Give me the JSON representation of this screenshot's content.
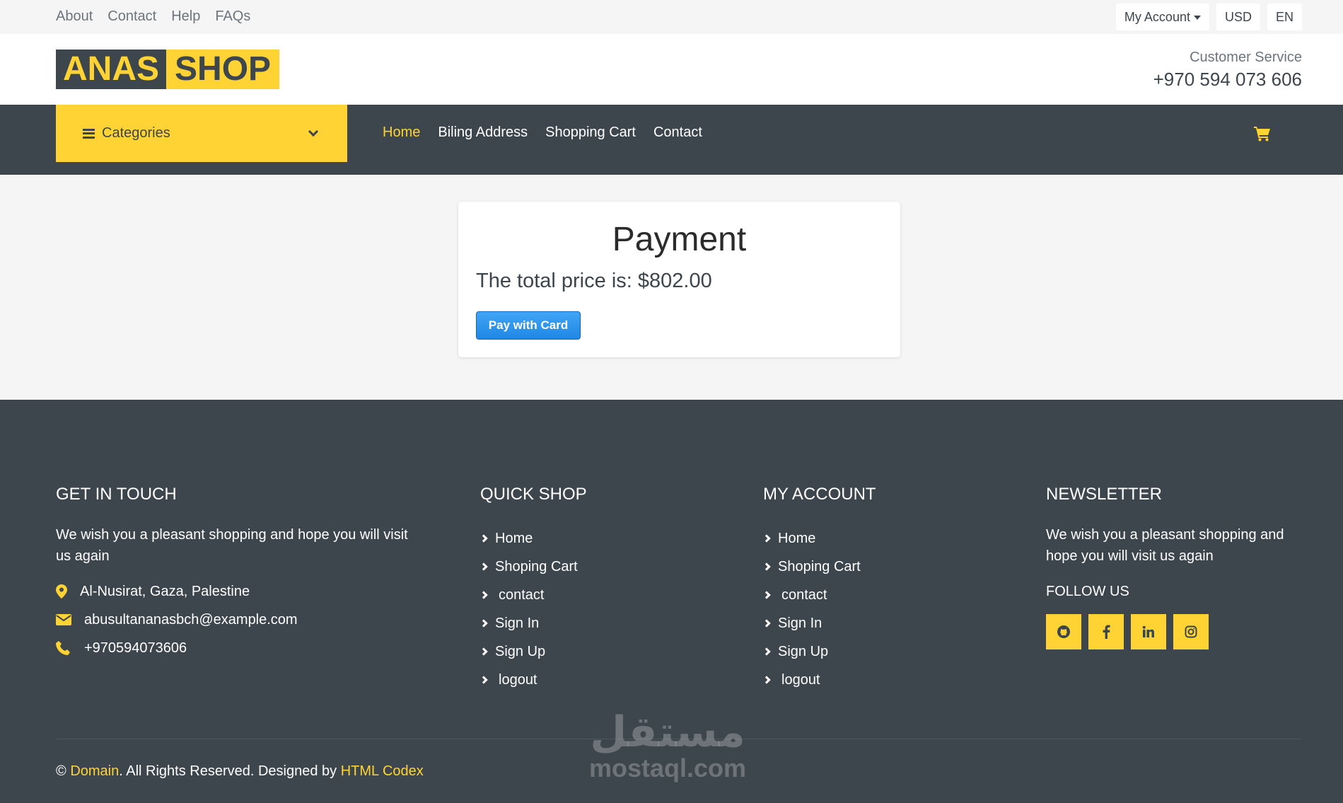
{
  "topbar": {
    "links": [
      "About",
      "Contact",
      "Help",
      "FAQs"
    ],
    "account_label": "My Account",
    "currency": "USD",
    "language": "EN"
  },
  "header": {
    "logo_part1": "ANAS",
    "logo_part2": "SHOP",
    "customer_service_label": "Customer Service",
    "customer_service_phone": "+970 594 073 606"
  },
  "nav": {
    "categories_label": "Categories",
    "links": [
      "Home",
      "Biling Address",
      "Shopping Cart",
      "Contact"
    ],
    "active_link": "Home"
  },
  "payment": {
    "title": "Payment",
    "total_text": "The total price is: $802.00",
    "pay_button": "Pay with Card"
  },
  "footer": {
    "get_in_touch": {
      "heading": "GET IN TOUCH",
      "text": "We wish you a pleasant shopping and hope you will visit us again",
      "address": "Al-Nusirat, Gaza, Palestine",
      "email": "abusultananasbch@example.com",
      "phone": "+970594073606"
    },
    "quick_shop": {
      "heading": "QUICK SHOP",
      "items": [
        "Home",
        "Shoping Cart",
        "contact",
        "Sign In",
        "Sign Up",
        "logout"
      ]
    },
    "my_account": {
      "heading": "MY ACCOUNT",
      "items": [
        "Home",
        "Shoping Cart",
        "contact",
        "Sign In",
        "Sign Up",
        "logout"
      ]
    },
    "newsletter": {
      "heading": "NEWSLETTER",
      "text": "We wish you a pleasant shopping and hope you will visit us again",
      "follow_label": "FOLLOW US",
      "social_icons": [
        "github-icon",
        "facebook-icon",
        "linkedin-icon",
        "instagram-icon"
      ]
    },
    "copyright": {
      "symbol": "©",
      "domain": "Domain",
      "middle": ". All Rights Reserved. Designed by",
      "designer": "HTML Codex"
    }
  },
  "watermark": {
    "arabic": "مستقل",
    "latin": "mostaql.com"
  },
  "colors": {
    "accent": "#ffd333",
    "dark": "#3d464d",
    "button_blue": "#1e88e5"
  }
}
